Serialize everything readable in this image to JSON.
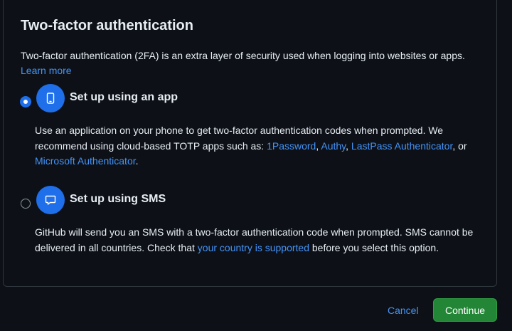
{
  "dialog": {
    "title": "Two-factor authentication",
    "intro": "Two-factor authentication (2FA) is an extra layer of security used when logging into websites or apps.",
    "learn_more": "Learn more"
  },
  "options": {
    "app": {
      "label": "Set up using an app",
      "selected": true,
      "icon": "mobile-phone-icon",
      "desc_start": "Use an application on your phone to get two-factor authentication codes when prompted. We recommend using cloud-based TOTP apps such as: ",
      "link_1password": "1Password",
      "sep1": ", ",
      "link_authy": "Authy",
      "sep2": ", ",
      "link_lastpass": "LastPass Authenticator",
      "sep3": ", or ",
      "link_microsoft": "Microsoft Authenticator",
      "desc_end": "."
    },
    "sms": {
      "label": "Set up using SMS",
      "selected": false,
      "icon": "message-icon",
      "desc_start": "GitHub will send you an SMS with a two-factor authentication code when prompted. SMS cannot be delivered in all countries. Check that ",
      "link_country": "your country is supported",
      "desc_end": " before you select this option."
    }
  },
  "actions": {
    "cancel": "Cancel",
    "continue": "Continue"
  },
  "colors": {
    "background": "#0d1117",
    "accent": "#1f6feb",
    "link": "#4493f8",
    "primary_button": "#238636"
  }
}
